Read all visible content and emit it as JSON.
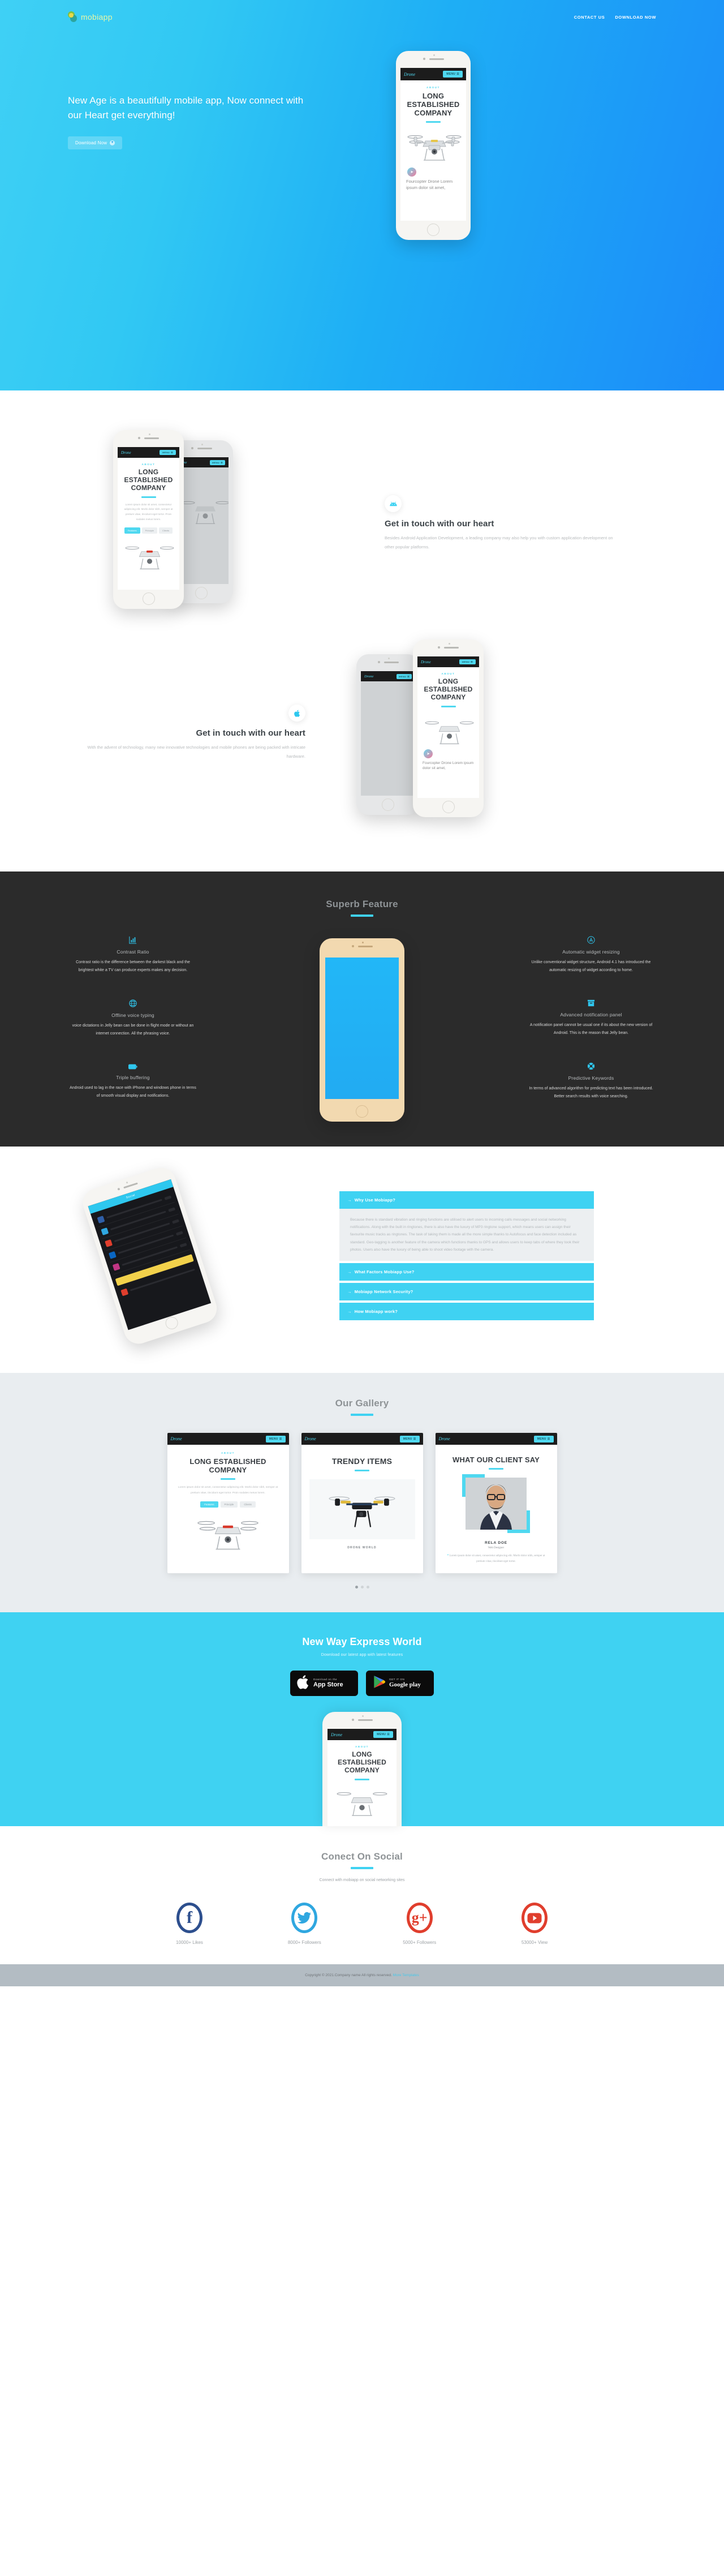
{
  "header": {
    "brand": "mobiapp",
    "nav": [
      {
        "label": "CONTACT US",
        "name": "nav-contact-us"
      },
      {
        "label": "DOWNLOAD NOW",
        "name": "nav-download-now"
      }
    ]
  },
  "hero": {
    "title": "New Age is a beautifully mobile app, Now connect with our Heart get everything!",
    "button": "Download Now",
    "button_icon": "download-icon"
  },
  "app_screen": {
    "logo": "Drone",
    "menu": "MENU",
    "kicker": "ABOUT",
    "heading": "LONG ESTABLISHED COMPANY",
    "caption": "Fourcopter Drone Lorem ipsum dolor sit amet,"
  },
  "showcase": [
    {
      "icon": "android-icon",
      "title": "Get in touch with our heart",
      "text": "Besides Android Application Development, a leading company may also help you with custom application development on other popular platforms.",
      "align": "left"
    },
    {
      "icon": "apple-icon",
      "title": "Get in touch with our heart",
      "text": "With the advent of technology, many new innovative technologies and mobile phones are being packed with intricate hardware.",
      "align": "right"
    }
  ],
  "features": {
    "title": "Superb Feature",
    "left": [
      {
        "icon": "bar-chart-icon",
        "title": "Contrast Ratio",
        "text": "Contrast ratio is the difference between the darkest black and the brightest white a TV can produce experts makes any decision."
      },
      {
        "icon": "globe-icon",
        "title": "Offline voice typing",
        "text": "voice dictations in Jelly bean can be done in flight mode or without an internet connection. All the phrasing voice."
      },
      {
        "icon": "battery-icon",
        "title": "Triple buffering",
        "text": "Android used to lag in the race with iPhone and windows phone in terms of smooth visual display and notifications."
      }
    ],
    "right": [
      {
        "icon": "app-store-icon",
        "title": "Automatic widget resizing",
        "text": "Unlike conventional widget structure, Android 4.1 has introduced the automatic resizing of widget according to home."
      },
      {
        "icon": "inbox-icon",
        "title": "Advanced notification panel",
        "text": "A notification panel cannot be usual one if its about the new version of Android. This is the reason that Jelly bean."
      },
      {
        "icon": "lifebuoy-icon",
        "title": "Predictive Keywords",
        "text": "In terms of advanced algorithm for predicting text has been introduced. Better search results with voice searching."
      }
    ]
  },
  "faq": {
    "items": [
      {
        "question": "Why Use Mobiapp?",
        "answer": "Because there is standard vibration and ringing functions are utilised to alert users to incoming calls messages and social networking notifications. Along with the built in ringtones, there is also have the luxury of MP3 ringtone support, which means users can assign their favourite music tracks as ringtones. The task of taking them is made all the more simple thanks to Autofocus and face detection included as standard. Geo-tagging is another feature of the camera which functions thanks to GPS and allows users to keep tabs of where they took their photos. Users also have the luxury of being able to shoot video footage with the camera.",
        "open": true
      },
      {
        "question": "What Factors Mobiapp Use?",
        "answer": "",
        "open": false
      },
      {
        "question": "Mobiapp Network Security?",
        "answer": "",
        "open": false
      },
      {
        "question": "How Mobiapp work?",
        "answer": "",
        "open": false
      }
    ]
  },
  "gallery": {
    "title": "Our Gallery",
    "cards": [
      {
        "logo": "Drone",
        "menu": "MENU",
        "kicker": "ABOUT",
        "heading": "LONG ESTABLISHED COMPANY",
        "body": "Lorem ipsum dolor sit amet, consectetur adipiscing elit. Morbi dolor nibh, semper at pretium vitae, tincidunt eget tortor. Proin sodales metus lorem.",
        "tabs": [
          "Features",
          "Principle",
          "Clients"
        ]
      },
      {
        "logo": "Drone",
        "menu": "MENU",
        "heading": "TRENDY ITEMS",
        "caption": "DRONE WORLD"
      },
      {
        "logo": "Drone",
        "menu": "MENU",
        "heading": "WHAT OUR CLIENT SAY",
        "person_name": "RELA DOE",
        "person_role": "Web Designer",
        "quote": "Lorem ipsum dolor sit amet, consectetur adipiscing elit. Morbi dolor nibh, semper at pretium vitae, tincidunt eget tortor."
      }
    ]
  },
  "cta": {
    "title": "New Way Express World",
    "subtitle": "Download our latest app with latest features",
    "buttons": [
      {
        "icon": "apple-icon",
        "sub": "Download on the",
        "main": "App Store",
        "name": "app-store-button"
      },
      {
        "icon": "google-play-icon",
        "sub": "GET IT ON",
        "main": "Google play",
        "name": "google-play-button"
      }
    ]
  },
  "social": {
    "title": "Conect On Social",
    "subtitle": "Connect with mobiapp on social networking sites",
    "items": [
      {
        "icon": "facebook-icon",
        "glyph": "f",
        "color": "#2d4f8e",
        "label": "10000+ Likes"
      },
      {
        "icon": "twitter-icon",
        "glyph": "t",
        "color": "#2fa7e0",
        "label": "8000+ Followers"
      },
      {
        "icon": "google-plus-icon",
        "glyph": "g+",
        "color": "#e03e2d",
        "label": "5000+ Followers"
      },
      {
        "icon": "youtube-icon",
        "glyph": "yt",
        "color": "#e03e2d",
        "label": "53000+ View"
      }
    ]
  },
  "footer": {
    "copyright": "Copyright © 2021.Company name All rights reserved.",
    "link": "More Templates"
  },
  "colors": {
    "accent": "#3fd2f2",
    "hero_start": "#3fd0f5",
    "hero_end": "#1b8bf9",
    "dark": "#2b2b2b",
    "gallery_bg": "#e9edf0"
  }
}
